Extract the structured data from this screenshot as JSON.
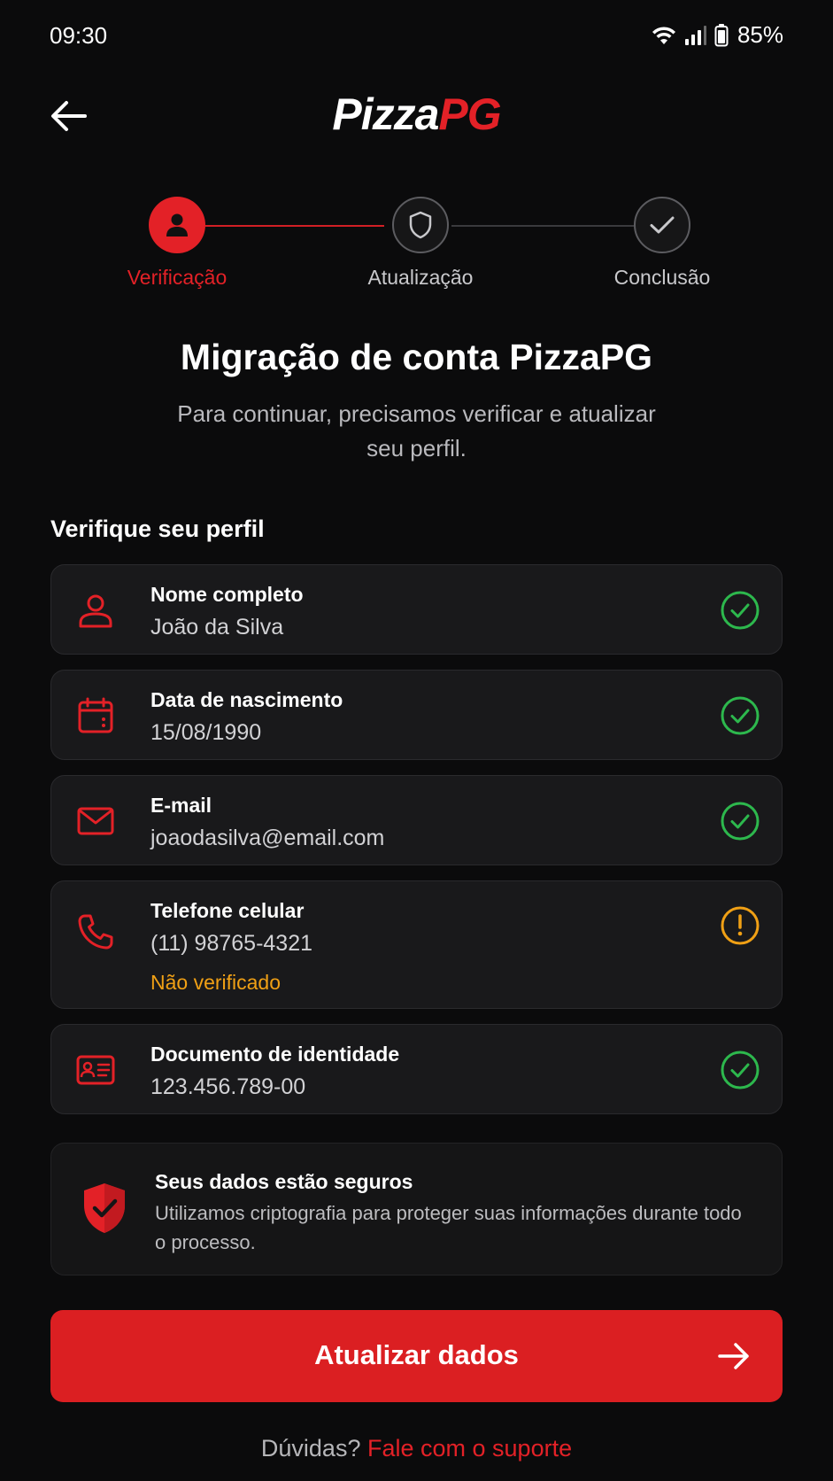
{
  "status_bar": {
    "time": "09:30",
    "battery": "85%",
    "icons": [
      "wifi-icon",
      "signal-icon",
      "battery-icon"
    ]
  },
  "header": {
    "back_icon": "arrow-left-icon",
    "logo_part1": "Pizza",
    "logo_part2": "PG"
  },
  "stepper": {
    "steps": [
      {
        "label": "Verificação",
        "icon": "user-icon",
        "state": "active"
      },
      {
        "label": "Atualização",
        "icon": "shield-icon",
        "state": "pending"
      },
      {
        "label": "Conclusão",
        "icon": "check-icon",
        "state": "pending"
      }
    ]
  },
  "page": {
    "title": "Migração de conta PizzaPG",
    "subtitle": "Para continuar, precisamos verificar e atualizar seu perfil."
  },
  "profile": {
    "section_title": "Verifique seu perfil",
    "fields": [
      {
        "label": "Nome completo",
        "value": "João da Silva",
        "icon": "user-icon",
        "status": "verified"
      },
      {
        "label": "Data de nascimento",
        "value": "15/08/1990",
        "icon": "calendar-icon",
        "status": "verified"
      },
      {
        "label": "E-mail",
        "value": "joaodasilva@email.com",
        "icon": "mail-icon",
        "status": "verified"
      },
      {
        "label": "Telefone celular",
        "value": "(11) 98765-4321",
        "icon": "phone-icon",
        "status": "warning",
        "note": "Não verificado"
      },
      {
        "label": "Documento de identidade",
        "value": "123.456.789-00",
        "icon": "id-card-icon",
        "status": "verified"
      }
    ]
  },
  "security": {
    "icon": "shield-check-icon",
    "title": "Seus dados estão seguros",
    "text": "Utilizamos criptografia para proteger suas informações durante todo o processo."
  },
  "cta": {
    "label": "Atualizar dados",
    "icon": "arrow-right-icon"
  },
  "help": {
    "prefix": "Dúvidas?",
    "link": "Fale com o suporte"
  },
  "colors": {
    "background": "#0b0b0c",
    "accent": "#e32127",
    "success": "#2db84d",
    "warning": "#f0a015",
    "card": "#19191b"
  }
}
